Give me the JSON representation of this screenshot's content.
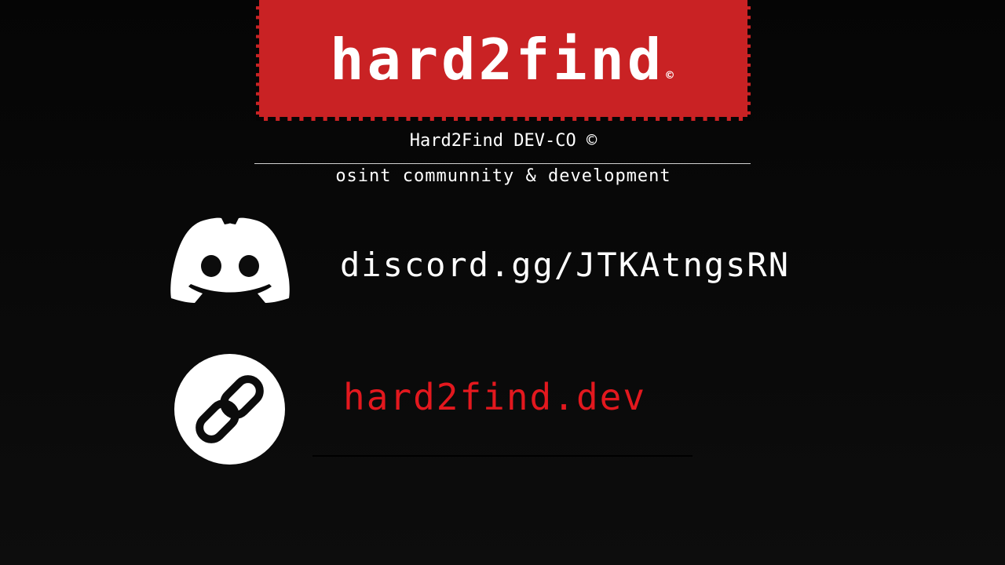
{
  "logo": {
    "text": "hard2find",
    "mark": "©"
  },
  "company": "Hard2Find DEV-CO ©",
  "tagline": "osint communnity & development",
  "discord": {
    "icon": "discord-icon",
    "link": "discord.gg/JTKAtngsRN"
  },
  "website": {
    "icon": "link-icon",
    "link": "hard2find.dev"
  },
  "colors": {
    "background": "#0c0c0c",
    "brand_red": "#c92224",
    "link_red": "#e3181e",
    "text": "#ffffff"
  }
}
